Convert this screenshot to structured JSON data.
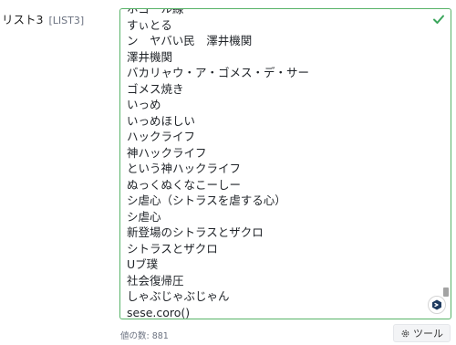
{
  "field": {
    "label": "リスト3",
    "key": "[LIST3]"
  },
  "list": {
    "items": [
      "ホゴール線",
      "すぃとる",
      "ン　ヤバい民　澤井機関",
      "澤井機関",
      "バカリャウ・ア・ゴメス・デ・サー",
      "ゴメス焼き",
      "いっめ",
      "いっめほしい",
      "ハックライフ",
      "神ハックライフ",
      "という神ハックライフ",
      "ぬっくぬくなこーしー",
      "シ虐心（シトラスを虐する心）",
      "シ虐心",
      "新登場のシトラスとザクロ",
      "シトラスとザクロ",
      "Uブ璞",
      "社会復帰圧",
      "しゃぶじゃぶじゃん",
      "sese.coro()"
    ],
    "scroll_position": 0.93
  },
  "footer": {
    "count_label": "値の数: 881",
    "tool_label": "ツール"
  },
  "colors": {
    "accent": "#58b368",
    "check": "#3aa55b"
  }
}
